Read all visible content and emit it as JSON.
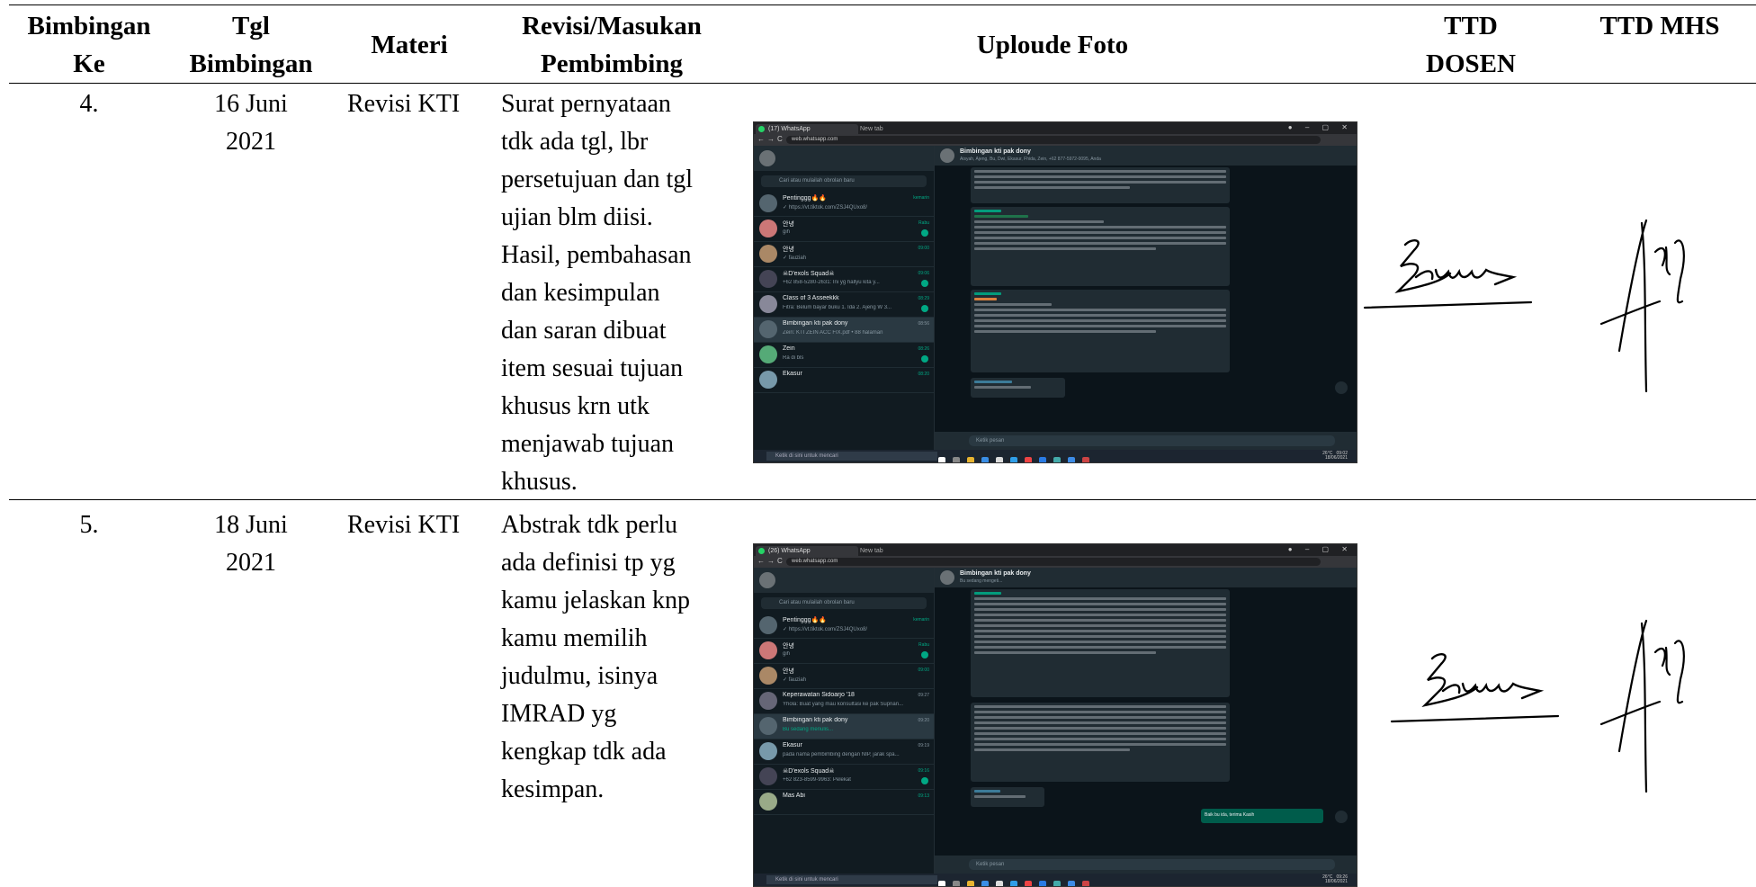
{
  "headers": {
    "bimbingan_ke": "Bimbingan Ke",
    "tgl_bimbingan": "Tgl Bimbingan",
    "materi": "Materi",
    "revisi": "Revisi/Masukan Pembimbing",
    "foto": "Uploude Foto",
    "ttd_dosen": "TTD DOSEN",
    "ttd_mhs": "TTD MHS"
  },
  "rows": [
    {
      "no": "4.",
      "tgl_line1": "16 Juni",
      "tgl_line2": "2021",
      "materi": "Revisi KTI",
      "revisi_lines": [
        "Surat pernyataan",
        "tdk ada tgl, lbr",
        "persetujuan dan tgl",
        "ujian blm diisi.",
        "Hasil, pembahasan",
        "dan kesimpulan",
        "dan saran dibuat",
        "item sesuai tujuan",
        "khusus krn utk",
        "menjawab tujuan",
        "khusus."
      ],
      "screenshot": {
        "tab1": "(17) WhatsApp",
        "tab2": "New tab",
        "url": "web.whatsapp.com",
        "group_title": "Bimbingan kti pak dony",
        "group_sub": "Aisyah, Ajeng, Bu, Dwi, Ekasur, Fhida, Zein, +62 877-5972-0095, Anda",
        "search_placeholder": "Cari atau mulailah obrolan baru",
        "chats": [
          {
            "name": "Pentinggg🔥🔥",
            "msg": "✓ https://vt.tiktok.com/ZSJ4QUxo8/",
            "time": "kemarin"
          },
          {
            "name": "안녕",
            "msg": "gih",
            "time": "Rabu"
          },
          {
            "name": "안녕",
            "msg": "✓ fauziah",
            "time": "09:00"
          },
          {
            "name": "☠D'exols Squad☠",
            "msg": "+62 858-5280-2631: Ini yg hallyu kita y...",
            "time": "09:06"
          },
          {
            "name": "Class of 3 Asseekkk",
            "msg": "Fitra: Belum bayar buku 1. Ida 2. Ajeng W 3...",
            "time": "08:29"
          },
          {
            "name": "Bimbingan kti pak dony",
            "msg": "Zein: KTI ZEIN ACC FIX.pdf • 88 halaman",
            "time": "08:56"
          },
          {
            "name": "Zein",
            "msg": "Ra di bls",
            "time": "08:26"
          },
          {
            "name": "Ekasur",
            "msg": "",
            "time": "08:20"
          }
        ],
        "compose_placeholder": "Ketik pesan",
        "taskbar_search": "Ketik di sini untuk mencari",
        "tray_time": "09:02",
        "tray_date": "18/06/2021",
        "weather": "26°C"
      }
    },
    {
      "no": "5.",
      "tgl_line1": "18 Juni",
      "tgl_line2": "2021",
      "materi": "Revisi KTI",
      "revisi_lines": [
        "Abstrak tdk perlu",
        "ada definisi tp yg",
        "kamu jelaskan knp",
        "kamu memilih",
        "judulmu, isinya",
        "IMRAD yg",
        "kengkap tdk ada",
        "kesimpan."
      ],
      "screenshot": {
        "tab1": "(26) WhatsApp",
        "tab2": "New tab",
        "url": "web.whatsapp.com",
        "group_title": "Bimbingan kti pak dony",
        "group_sub": "Bu sedang mengeti...",
        "search_placeholder": "Cari atau mulailah obrolan baru",
        "chats": [
          {
            "name": "Pentinggg🔥🔥",
            "msg": "✓ https://vt.tiktok.com/ZSJ4QUxo8/",
            "time": "kemarin"
          },
          {
            "name": "안녕",
            "msg": "gih",
            "time": "Rabu"
          },
          {
            "name": "안녕",
            "msg": "✓ fauziah",
            "time": "09:00"
          },
          {
            "name": "Keperawatan Sidoarjo '18",
            "msg": "Yhola: Buat yang mau konsultasi ke pak Suprian...",
            "time": "09:27"
          },
          {
            "name": "Bimbingan kti pak dony",
            "msg": "Bu sedang menulis...",
            "time": "09:20"
          },
          {
            "name": "Ekasur",
            "msg": "pada nama pembimbing dengan NIP, jarak spa...",
            "time": "09:19"
          },
          {
            "name": "☠D'exols Squad☠",
            "msg": "+62 823-8599-9963: Pelekat",
            "time": "09:16"
          },
          {
            "name": "Mas Abi",
            "msg": "",
            "time": "09:13"
          }
        ],
        "out_msg": "Baik bu ida, terima Kasih",
        "compose_placeholder": "Ketik pesan",
        "taskbar_search": "Ketik di sini untuk mencari",
        "tray_time": "09:26",
        "tray_date": "18/06/2021",
        "weather": "26°C"
      }
    }
  ]
}
